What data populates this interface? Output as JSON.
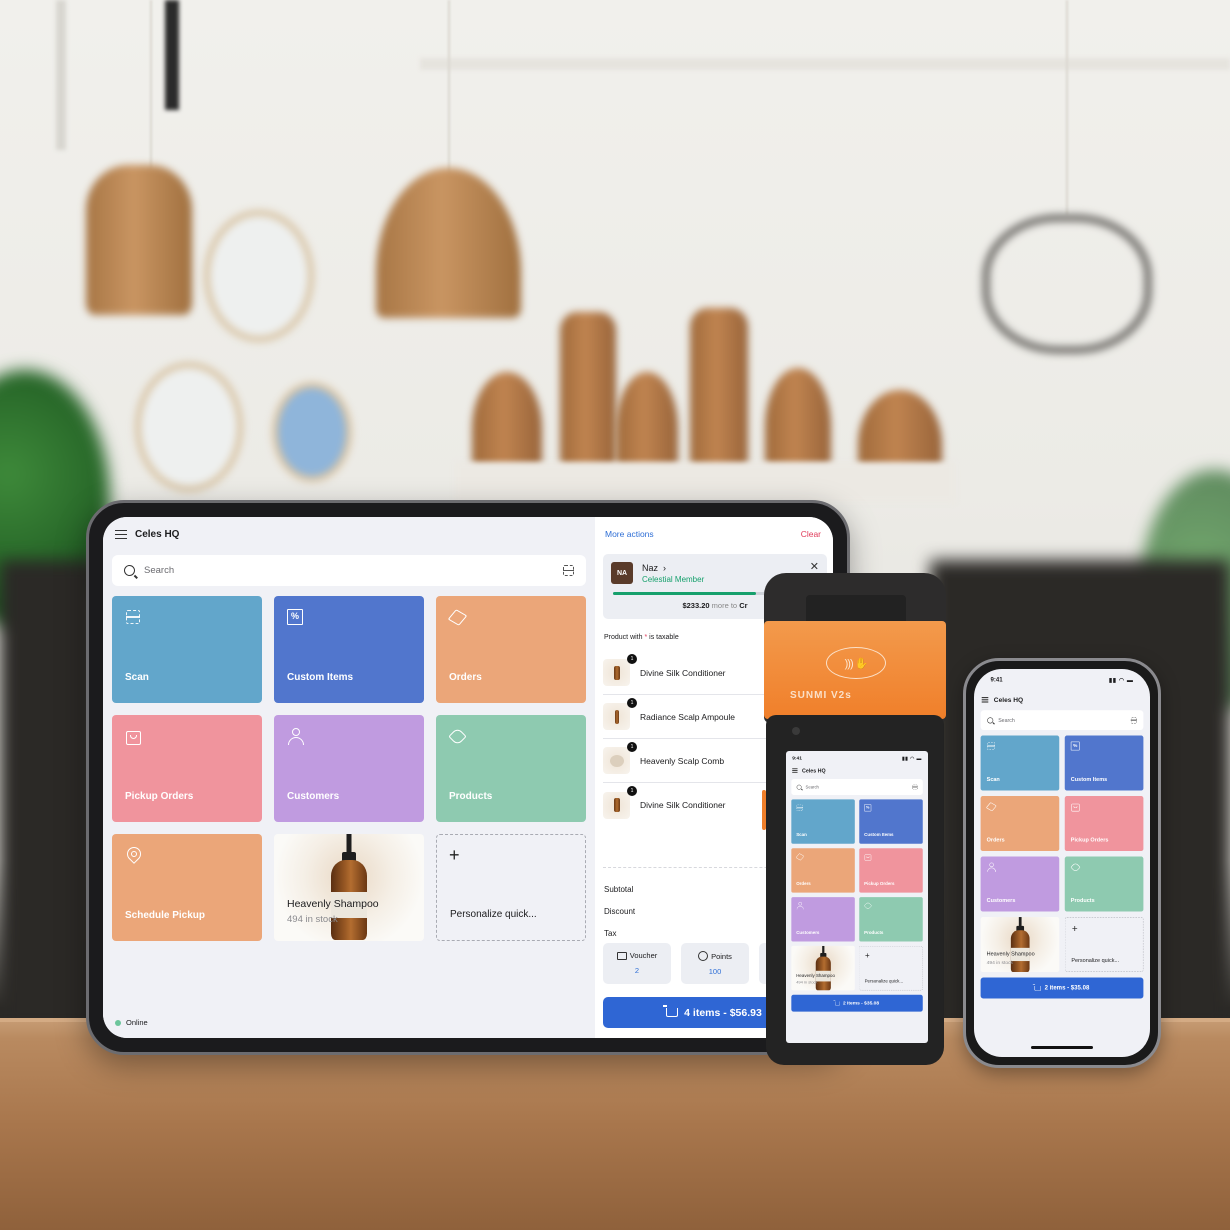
{
  "colors": {
    "scan": "#62a6cb",
    "custom_items": "#5176cd",
    "orders": "#eba679",
    "pickup_orders": "#f0949d",
    "customers": "#c09be0",
    "products": "#8ecab0",
    "schedule_pickup": "#eba679",
    "accent_blue": "#2f66d4",
    "link_blue": "#2f6fd6",
    "danger_red": "#e03b5a",
    "member_green": "#16a06c",
    "online_green": "#6cc59b"
  },
  "tablet": {
    "header": {
      "title": "Celes HQ",
      "menu_icon": "hamburger-icon"
    },
    "search": {
      "placeholder": "Search",
      "scan_icon": "barcode-scan-icon"
    },
    "tiles": [
      {
        "label": "Scan",
        "icon": "scan-icon",
        "color_key": "scan"
      },
      {
        "label": "Custom Items",
        "icon": "percent-receipt-icon",
        "color_key": "custom_items"
      },
      {
        "label": "Orders",
        "icon": "box-icon",
        "color_key": "orders"
      },
      {
        "label": "Pickup Orders",
        "icon": "shopping-bag-icon",
        "color_key": "pickup_orders"
      },
      {
        "label": "Customers",
        "icon": "user-icon",
        "color_key": "customers"
      },
      {
        "label": "Products",
        "icon": "tag-icon",
        "color_key": "products"
      },
      {
        "label": "Schedule Pickup",
        "icon": "location-pin-icon",
        "color_key": "schedule_pickup"
      }
    ],
    "product_tile": {
      "name": "Heavenly Shampoo",
      "stock": "494 in stock"
    },
    "add_tile": {
      "label": "Personalize quick...",
      "icon": "plus-icon"
    },
    "status": {
      "label": "Online"
    },
    "cart": {
      "more_actions": "More actions",
      "clear": "Clear",
      "member": {
        "initials": "NA",
        "name": "Naz",
        "tier": "Celestial Member",
        "progress_fraction": 0.7,
        "amount_more": "$233.20",
        "caption_mid": "more to",
        "caption_next": "Cr"
      },
      "taxable_note_prefix": "Product with",
      "taxable_note_star": "*",
      "taxable_note_suffix": "is taxable",
      "items": [
        {
          "name": "Divine Silk Conditioner",
          "qty": "1",
          "thumb": "bottle"
        },
        {
          "name": "Radiance Scalp Ampoule",
          "qty": "1",
          "thumb": "bottle"
        },
        {
          "name": "Heavenly Scalp Comb",
          "qty": "1",
          "thumb": "comb"
        },
        {
          "name": "Divine Silk Conditioner",
          "qty": "1",
          "thumb": "bottle"
        }
      ],
      "totals": [
        "Subtotal",
        "Discount",
        "Tax"
      ],
      "promos": [
        {
          "label": "Voucher",
          "value": "2",
          "icon": "voucher-icon"
        },
        {
          "label": "Points",
          "value": "100",
          "icon": "star-points-icon"
        }
      ],
      "checkout": "4 items - $56.93"
    }
  },
  "sunmi": {
    "brand": "SUNMI V2s",
    "nfc_icon": "contactless-payment-icon",
    "time": "9:41",
    "title": "Celes HQ",
    "search_placeholder": "Search",
    "tiles": [
      {
        "label": "Scan",
        "icon": "scan-icon",
        "color_key": "scan"
      },
      {
        "label": "Custom Items",
        "icon": "percent-receipt-icon",
        "color_key": "custom_items"
      },
      {
        "label": "Orders",
        "icon": "box-icon",
        "color_key": "orders"
      },
      {
        "label": "Pickup Orders",
        "icon": "shopping-bag-icon",
        "color_key": "pickup_orders"
      },
      {
        "label": "Customers",
        "icon": "user-icon",
        "color_key": "customers"
      },
      {
        "label": "Products",
        "icon": "tag-icon",
        "color_key": "products"
      }
    ],
    "product_tile": {
      "name": "Heavenly Shampoo",
      "stock": "494 in stock"
    },
    "add_tile": {
      "label": "Personalize quick..."
    },
    "checkout": "2 items - $35.08"
  },
  "iphone": {
    "time": "9:41",
    "title": "Celes HQ",
    "search_placeholder": "Search",
    "tiles": [
      {
        "label": "Scan",
        "icon": "scan-icon",
        "color_key": "scan"
      },
      {
        "label": "Custom Items",
        "icon": "percent-receipt-icon",
        "color_key": "custom_items"
      },
      {
        "label": "Orders",
        "icon": "box-icon",
        "color_key": "orders"
      },
      {
        "label": "Pickup Orders",
        "icon": "shopping-bag-icon",
        "color_key": "pickup_orders"
      },
      {
        "label": "Customers",
        "icon": "user-icon",
        "color_key": "customers"
      },
      {
        "label": "Products",
        "icon": "tag-icon",
        "color_key": "products"
      }
    ],
    "product_tile": {
      "name": "Heavenly Shampoo",
      "stock": "494 in stock"
    },
    "add_tile": {
      "label": "Personalize quick..."
    },
    "checkout": "2 items - $35.08"
  }
}
